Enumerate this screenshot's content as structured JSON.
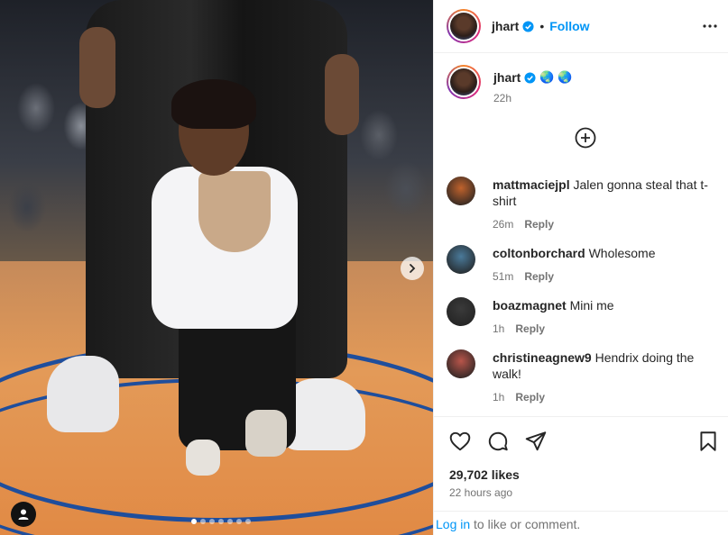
{
  "photo": {
    "alt": "",
    "dots": 7,
    "active_dot": 1
  },
  "header": {
    "username": "jhart",
    "separator": "•",
    "follow_label": "Follow"
  },
  "caption": {
    "username": "jhart",
    "emojis": "🌏 🌏",
    "time": "22h"
  },
  "comments": [
    {
      "user": "mattmaciejpl",
      "text": "Jalen gonna steal that t-shirt",
      "time": "26m",
      "reply": "Reply",
      "avatar_color": "#c0622c"
    },
    {
      "user": "coltonborchard",
      "text": "Wholesome",
      "time": "51m",
      "reply": "Reply",
      "avatar_color": "#4a7a9a"
    },
    {
      "user": "boazmagnet",
      "text": "Mini me",
      "time": "1h",
      "reply": "Reply",
      "avatar_color": "#3a3a3a"
    },
    {
      "user": "christineagnew9",
      "text": "Hendrix doing the walk!",
      "time": "1h",
      "reply": "Reply",
      "avatar_color": "#b8554a"
    }
  ],
  "stats": {
    "likes": "29,702 likes",
    "posted": "22 hours ago"
  },
  "login": {
    "link": "Log in",
    "rest": " to like or comment."
  },
  "colors": {
    "accent": "#0095f6",
    "muted": "#737373"
  }
}
